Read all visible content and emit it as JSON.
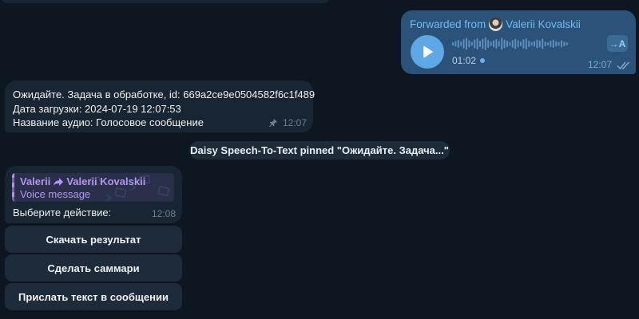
{
  "colors": {
    "background": "#0e1621",
    "incoming_bubble": "#182533",
    "outgoing_bubble": "#2b5278",
    "link_blue": "#71baf2",
    "reply_purple": "#b594f5"
  },
  "voice_message": {
    "forwarded_prefix": "Forwarded from",
    "forwarded_name": "Valerii Kovalskii",
    "duration": "01:02",
    "transcribe_label": "→A",
    "time": "12:07",
    "status_icon": "double-check-icon"
  },
  "status_message": {
    "lines": [
      "Ожидайте. Задача в обработке, id: 669a2ce9e0504582f6c1f489",
      "Дата загрузки: 2024-07-19 12:07:53",
      "Название аудио: Голосовое сообщение"
    ],
    "time": "12:07",
    "pin_icon": "pin-icon"
  },
  "service_message": {
    "text": "Daisy Speech-To-Text pinned \"Ожидайте. Задача...\""
  },
  "bot_message": {
    "reply_sender": "Valerii",
    "reply_forward_name": "Valerii Kovalskii",
    "reply_subtitle": "Voice message",
    "text": "Выберите действие:",
    "time": "12:08"
  },
  "keyboard": {
    "buttons": [
      "Скачать результат",
      "Сделать саммари",
      "Прислать текст в сообщении"
    ]
  }
}
